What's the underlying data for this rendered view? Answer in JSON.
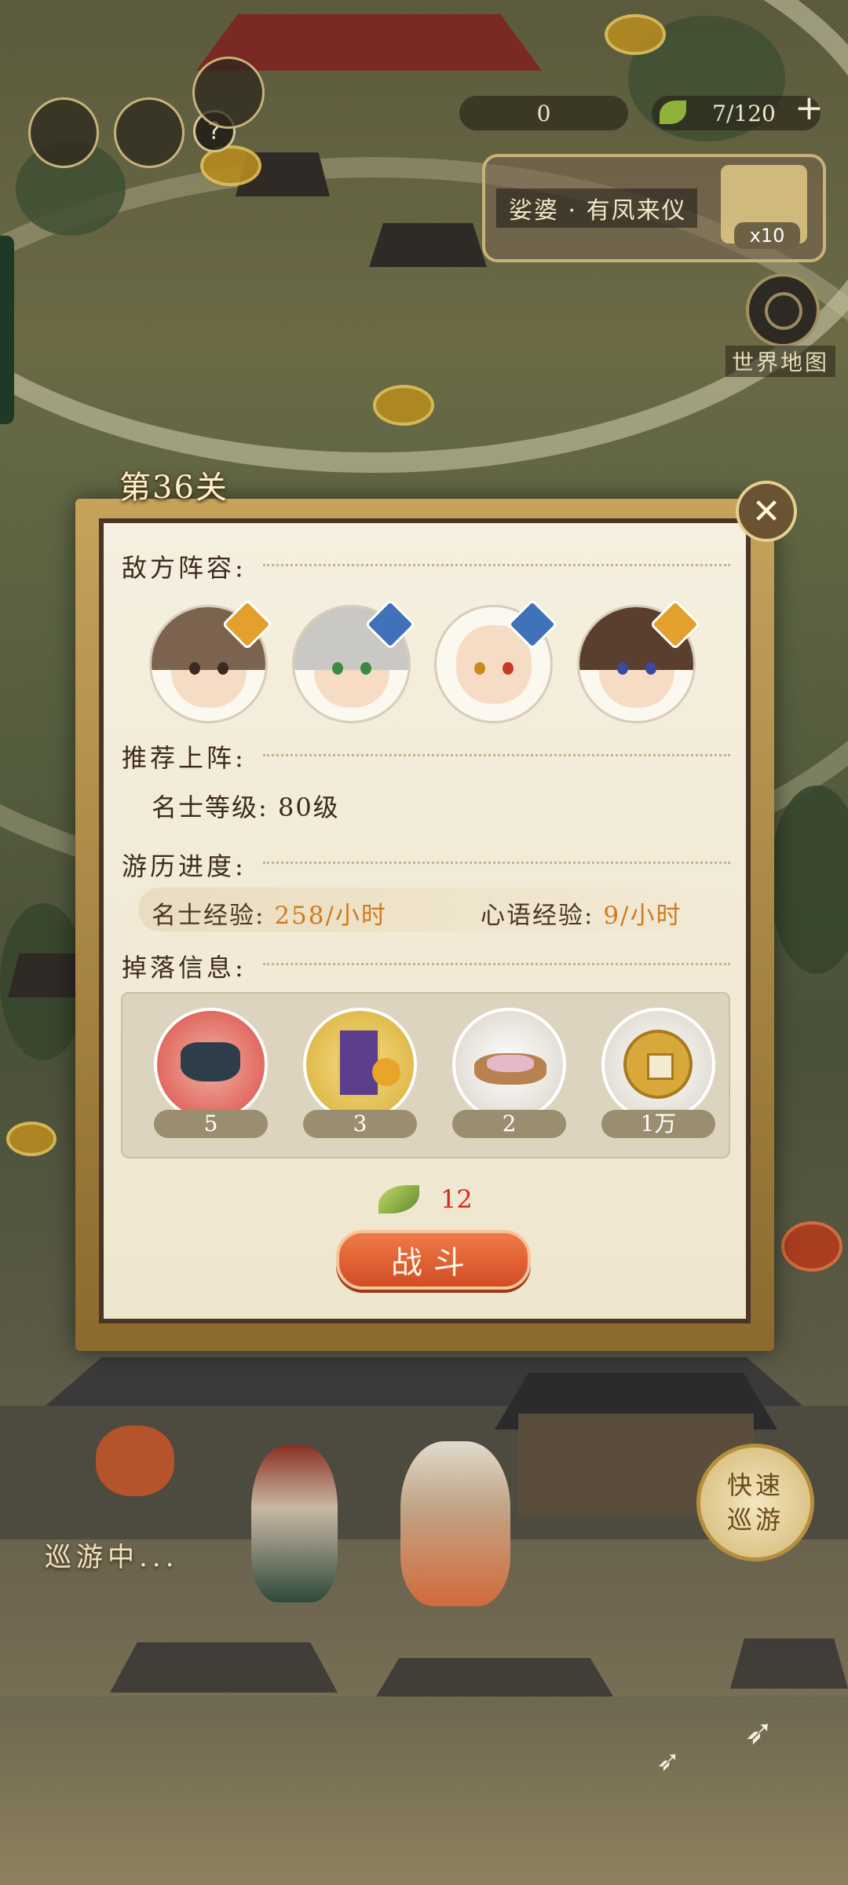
{
  "hud": {
    "currency_value": "0",
    "stamina": "7/120",
    "plus_symbol": "+",
    "help_symbol": "?"
  },
  "quest": {
    "title": "娑婆 · 有凤来仪",
    "multiplier": "x10"
  },
  "world_map": {
    "label": "世界地图"
  },
  "modal": {
    "stage_title": "第36关",
    "close_symbol": "✕",
    "enemy_label": "敌方阵容:",
    "recommend_label": "推荐上阵:",
    "recommend_level": "名士等级: 80级",
    "progress_label": "游历进度:",
    "exp_mingshi_label": "名士经验: ",
    "exp_mingshi_value": "258/小时",
    "exp_xinyu_label": "心语经验: ",
    "exp_xinyu_value": "9/小时",
    "drop_label": "掉落信息:",
    "drops": [
      {
        "icon": "tea-set-icon",
        "qty": "5"
      },
      {
        "icon": "scroll-card-icon",
        "qty": "3"
      },
      {
        "icon": "flower-tray-icon",
        "qty": "2"
      },
      {
        "icon": "copper-coin-icon",
        "qty": "1万"
      }
    ],
    "cost_value": "12",
    "fight_label": "战斗"
  },
  "status": {
    "patrolling_text": "巡游中...",
    "fast_patrol_label": "快速巡游"
  },
  "colors": {
    "accent_red": "#d32a1c",
    "exp_orange": "#d07a1e",
    "fight_button": "#e0602f",
    "frame_gold": "#c6a35b"
  }
}
